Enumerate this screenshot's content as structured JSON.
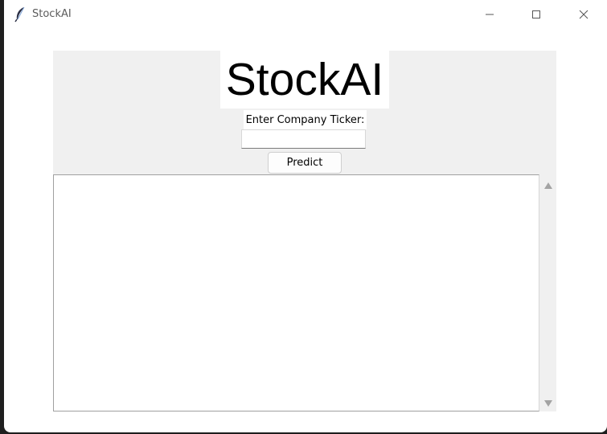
{
  "window": {
    "title": "StockAI",
    "icon": "feather-icon",
    "controls": [
      "minimize-icon",
      "maximize-icon",
      "close-icon"
    ]
  },
  "app": {
    "heading": "StockAI",
    "ticker_label": "Enter Company Ticker:",
    "ticker_value": "",
    "ticker_placeholder": "",
    "predict_label": "Predict",
    "output_text": ""
  },
  "colors": {
    "panel_background": "#f0f0f0",
    "field_background": "#ffffff"
  }
}
